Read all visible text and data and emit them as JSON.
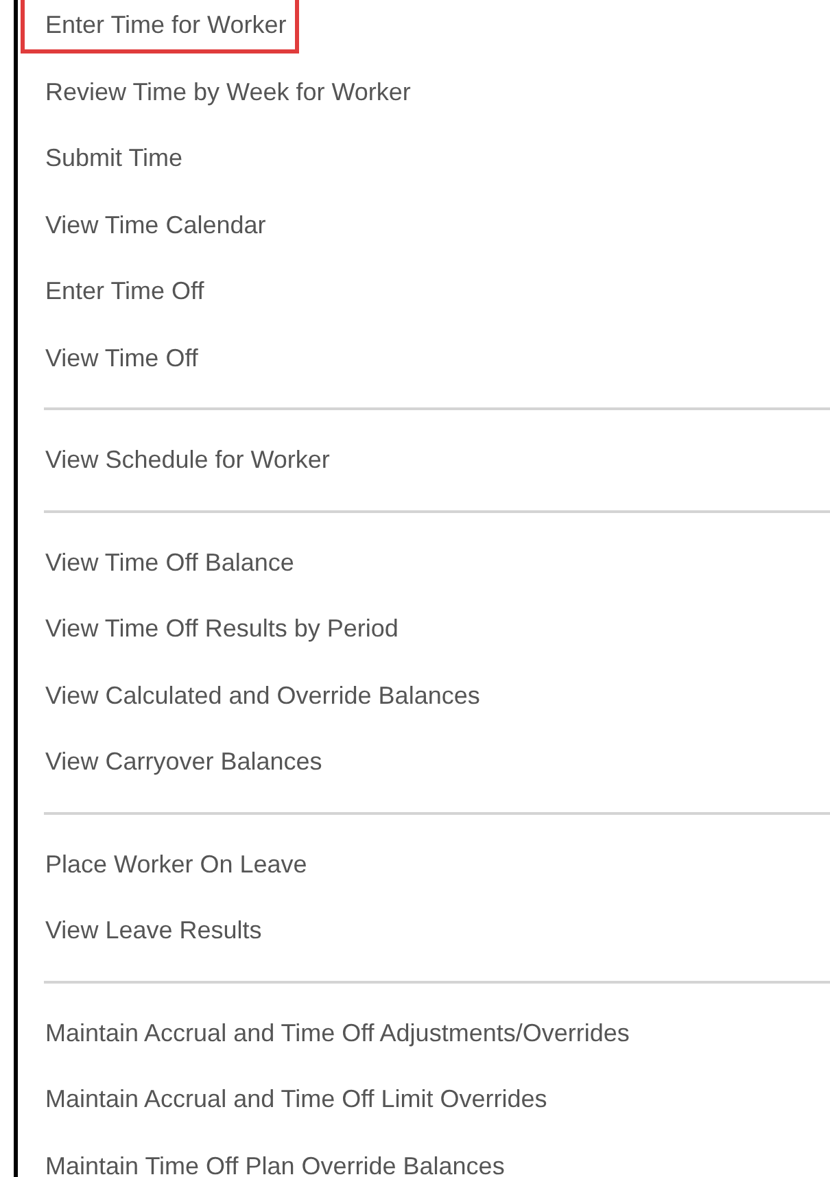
{
  "menu_groups": [
    {
      "items": [
        {
          "label": "Enter Time for Worker",
          "highlighted": true
        },
        {
          "label": "Review Time by Week for Worker",
          "highlighted": false
        },
        {
          "label": "Submit Time",
          "highlighted": false
        },
        {
          "label": "View Time Calendar",
          "highlighted": false
        },
        {
          "label": "Enter Time Off",
          "highlighted": false
        },
        {
          "label": "View Time Off",
          "highlighted": false
        }
      ]
    },
    {
      "items": [
        {
          "label": "View Schedule for Worker",
          "highlighted": false
        }
      ]
    },
    {
      "items": [
        {
          "label": "View Time Off Balance",
          "highlighted": false
        },
        {
          "label": "View Time Off Results by Period",
          "highlighted": false
        },
        {
          "label": "View Calculated and Override Balances",
          "highlighted": false
        },
        {
          "label": "View Carryover Balances",
          "highlighted": false
        }
      ]
    },
    {
      "items": [
        {
          "label": "Place Worker On Leave",
          "highlighted": false
        },
        {
          "label": "View Leave Results",
          "highlighted": false
        }
      ]
    },
    {
      "items": [
        {
          "label": "Maintain Accrual and Time Off Adjustments/Overrides",
          "highlighted": false
        },
        {
          "label": "Maintain Accrual and Time Off Limit Overrides",
          "highlighted": false
        },
        {
          "label": "Maintain Time Off Plan Override Balances",
          "highlighted": false
        }
      ]
    }
  ]
}
